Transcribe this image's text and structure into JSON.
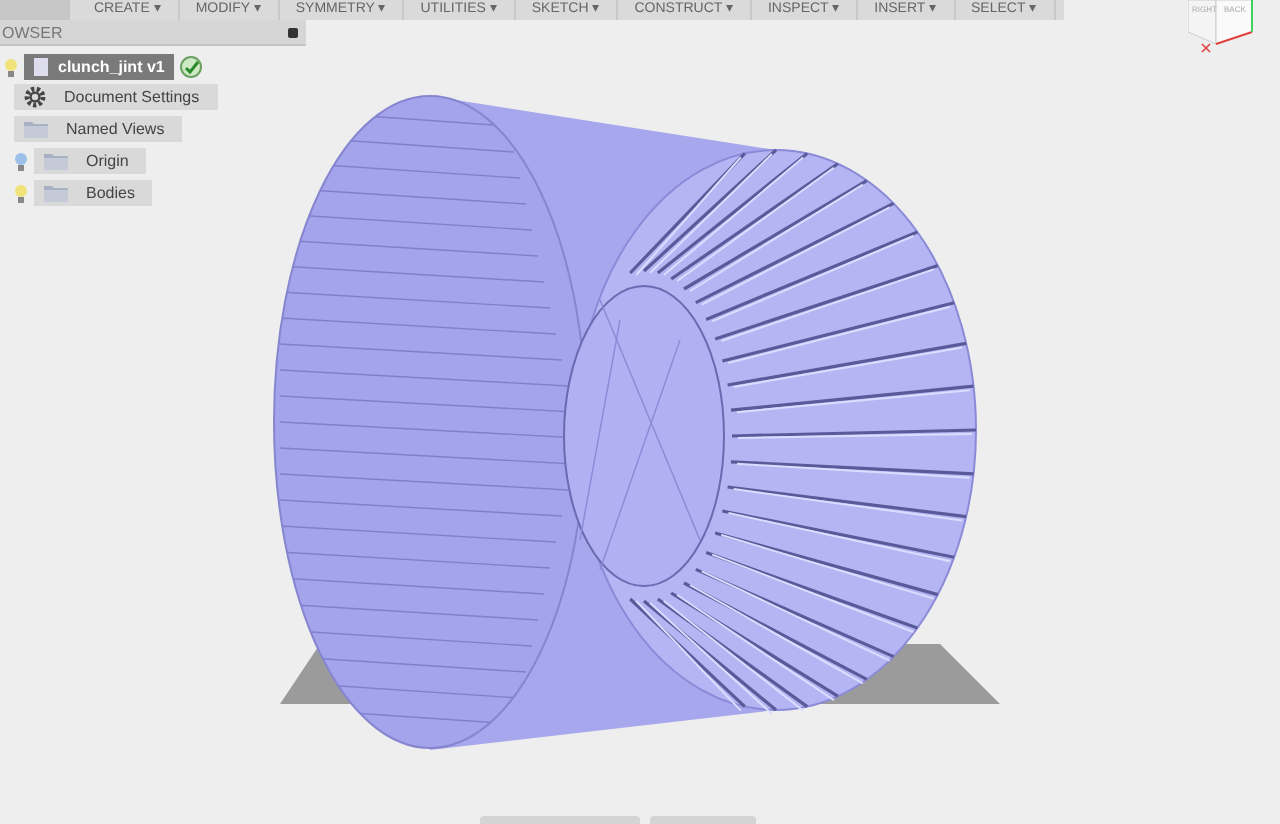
{
  "toolbar": {
    "menus": [
      "CREATE ▾",
      "MODIFY ▾",
      "SYMMETRY ▾",
      "UTILITIES ▾",
      "SKETCH ▾",
      "CONSTRUCT ▾",
      "INSPECT ▾",
      "INSERT ▾",
      "SELECT ▾"
    ]
  },
  "browser": {
    "title": "OWSER",
    "root": {
      "label": "clunch_jint v1",
      "visible": true,
      "active": true,
      "selected": true,
      "children": [
        {
          "label": "Document Settings",
          "kind": "settings",
          "selected": false
        },
        {
          "label": "Named Views",
          "kind": "folder",
          "selected": false
        },
        {
          "label": "Origin",
          "kind": "folder",
          "visible": false,
          "selected": false
        },
        {
          "label": "Bodies",
          "kind": "folder",
          "visible": true,
          "selected": false
        }
      ]
    }
  },
  "view_cube": {
    "faces": [
      "RIGHT",
      "BACK"
    ]
  }
}
